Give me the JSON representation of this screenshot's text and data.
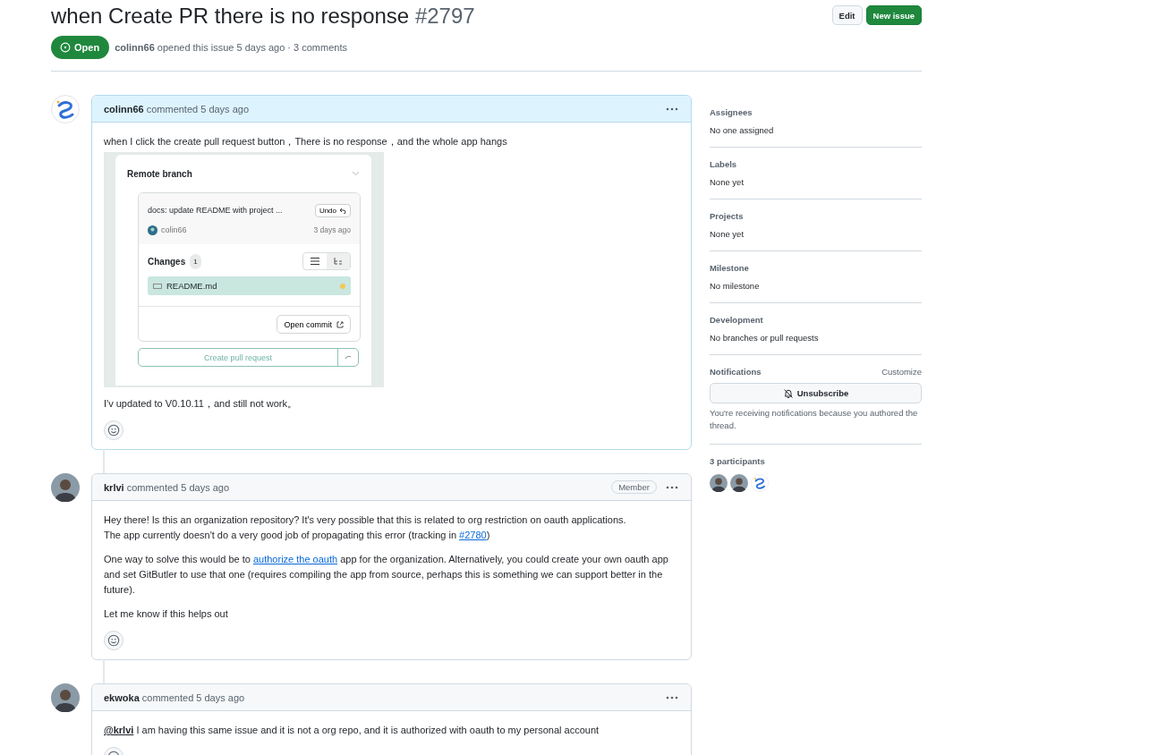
{
  "issue": {
    "title": "when Create PR there is no response",
    "number": "#2797",
    "state": "Open",
    "author": "colinn66",
    "meta": "opened this issue 5 days ago · 3 comments"
  },
  "header_buttons": [
    {
      "label": "Edit",
      "kind": "default"
    },
    {
      "label": "New issue",
      "kind": "primary"
    }
  ],
  "comments": [
    {
      "author": "colinn66",
      "time": "commented 5 days ago",
      "avatar": {
        "kind": "logo"
      },
      "highlighted": true,
      "blocks": [
        {
          "kind": "paragraph",
          "segments": [
            {
              "kind": "text",
              "text": "when I click the create pull request button，There is no response，and the whole app hangs"
            }
          ]
        },
        {
          "kind": "screenshot",
          "title": "Remote branch",
          "commit_message": "docs: update README with project ...",
          "undo": "Undo",
          "commit_author": "colin66",
          "commit_time": "3 days ago",
          "changes_label": "Changes",
          "changes_count": "1",
          "files": [
            {
              "name": "README.md",
              "selected": true
            }
          ],
          "open_commit": "Open commit",
          "create_pr": "Create pull request"
        },
        {
          "kind": "paragraph",
          "segments": [
            {
              "kind": "text",
              "text": "I'v updated to V0.10.11，and still not work。"
            }
          ]
        }
      ]
    },
    {
      "author": "krlvi",
      "time": "commented 5 days ago",
      "avatar": {
        "kind": "person"
      },
      "badge": "Member",
      "highlighted": false,
      "blocks": [
        {
          "kind": "paragraph",
          "segments": [
            {
              "kind": "text",
              "text": "Hey there! Is this an organization repository? It's very possible that this is related to org restriction on oauth applications.\nThe app currently doesn't do a very good job of propagating this error (tracking in "
            },
            {
              "kind": "link",
              "text": "#2780"
            },
            {
              "kind": "text",
              "text": ")"
            }
          ]
        },
        {
          "kind": "paragraph",
          "segments": [
            {
              "kind": "text",
              "text": "One way to solve this would be to "
            },
            {
              "kind": "link",
              "text": "authorize the oauth"
            },
            {
              "kind": "text",
              "text": " app for the organization. Alternatively, you could create your own oauth app and set GitButler to use that one (requires compiling the app from source, perhaps this is something we can support better in the future)."
            }
          ]
        },
        {
          "kind": "paragraph",
          "segments": [
            {
              "kind": "text",
              "text": "Let me know if this helps out"
            }
          ]
        }
      ]
    },
    {
      "author": "ekwoka",
      "time": "commented 5 days ago",
      "avatar": {
        "kind": "person"
      },
      "highlighted": false,
      "blocks": [
        {
          "kind": "paragraph",
          "segments": [
            {
              "kind": "mention",
              "text": "@krlvi"
            },
            {
              "kind": "text",
              "text": " I am having this same issue and it is not a org repo, and it is authorized with oauth to my personal account"
            }
          ]
        }
      ]
    }
  ],
  "sidebar": {
    "sections": [
      {
        "heading": "Assignees",
        "value": "No one assigned"
      },
      {
        "heading": "Labels",
        "value": "None yet"
      },
      {
        "heading": "Projects",
        "value": "None yet"
      },
      {
        "heading": "Milestone",
        "value": "No milestone"
      },
      {
        "heading": "Development",
        "value": "No branches or pull requests"
      }
    ],
    "notifications": {
      "heading": "Notifications",
      "action": "Customize",
      "button": "Unsubscribe",
      "note": "You're receiving notifications because you authored the thread."
    },
    "participants": {
      "label": "3 participants",
      "avatars": [
        {
          "kind": "person"
        },
        {
          "kind": "person"
        },
        {
          "kind": "logo"
        }
      ]
    }
  }
}
